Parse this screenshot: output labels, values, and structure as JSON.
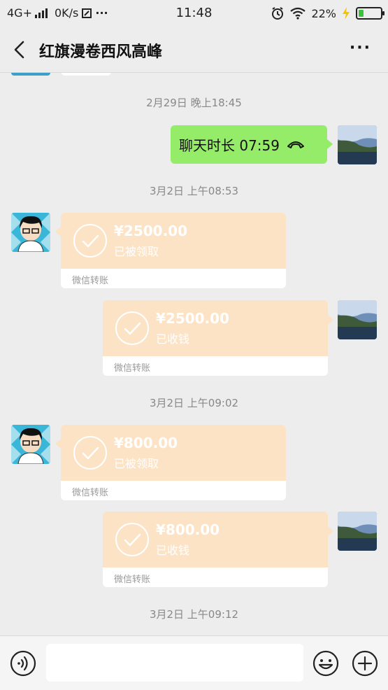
{
  "status_bar": {
    "network": "4G+",
    "speed": "0K/s",
    "time": "11:48",
    "battery": "22%",
    "battery_level": 0.22
  },
  "header": {
    "title": "红旗漫卷西风高峰",
    "more_label": "···"
  },
  "chat": {
    "timestamps": [
      "2月29日 晚上18:45",
      "3月2日 上午08:53",
      "3月2日 上午09:02",
      "3月2日 上午09:12"
    ],
    "call_message": {
      "text": "聊天时长 07:59"
    },
    "transfers": [
      {
        "amount": "¥2500.00",
        "status": "已被领取",
        "label": "微信转账",
        "side": "left"
      },
      {
        "amount": "¥2500.00",
        "status": "已收钱",
        "label": "微信转账",
        "side": "right"
      },
      {
        "amount": "¥800.00",
        "status": "已被领取",
        "label": "微信转账",
        "side": "left"
      },
      {
        "amount": "¥800.00",
        "status": "已收钱",
        "label": "微信转账",
        "side": "right"
      }
    ]
  },
  "input": {
    "value": "",
    "placeholder": ""
  },
  "colors": {
    "chat_bg": "#ededed",
    "sent_bubble": "#95ec69",
    "transfer_bg": "#fde3c6",
    "battery_fill": "#3cc13c"
  }
}
